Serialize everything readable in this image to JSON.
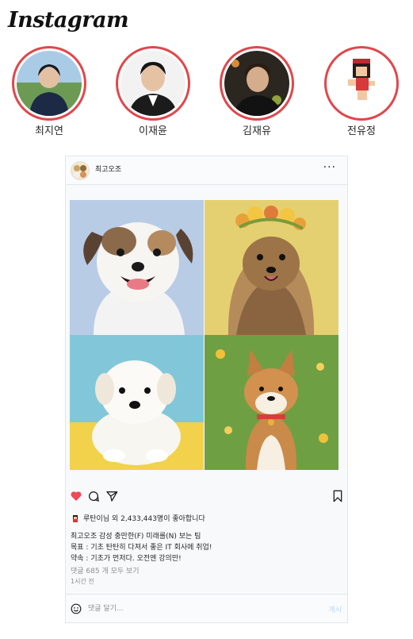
{
  "app": {
    "logo": "Instagram"
  },
  "stories": [
    {
      "name": "최지연"
    },
    {
      "name": "이재윤"
    },
    {
      "name": "김재유"
    },
    {
      "name": "전유정"
    }
  ],
  "post": {
    "username": "최고오조",
    "more_icon": "···",
    "image_icons": [
      "puppy-shihtzu",
      "puppy-yorkie",
      "puppy-pyrenees",
      "puppy-shiba"
    ],
    "likes_prefix": "루탄이님 외 2,433,443명이 좋아합니다",
    "caption_lines": [
      "최고오조 감성 충만한(F) 미래를(N) 보는 팀",
      "목표 : 기초 탄탄히 다져서 좋은 IT 회사에 취업!",
      "약속 : 기초가 먼저다. 오전엔 강의만!"
    ],
    "view_comments": "댓글 685 개 모두 보기",
    "time": "1시간 전",
    "comment_placeholder": "댓글 달기...",
    "comment_submit": "게시",
    "heart_color": "#ed4956",
    "ring_color": "#e0474c"
  }
}
